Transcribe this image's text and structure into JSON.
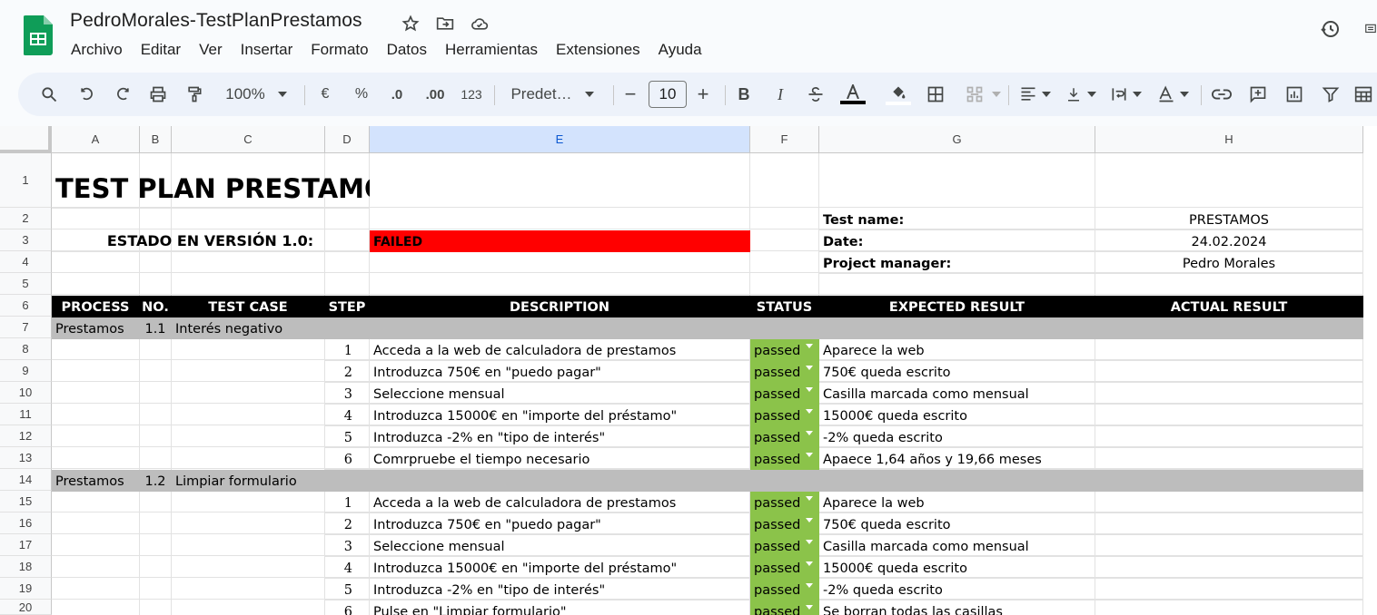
{
  "app": {
    "title": "PedroMorales-TestPlanPrestamos",
    "menus": [
      "Archivo",
      "Editar",
      "Ver",
      "Insertar",
      "Formato",
      "Datos",
      "Herramientas",
      "Extensiones",
      "Ayuda"
    ]
  },
  "toolbar": {
    "zoom": "100%",
    "font": "Predet…",
    "font_size": "10",
    "currency": "€",
    "percent": "%",
    "dec_less": ".0",
    "dec_more": ".00",
    "number_format": "123",
    "bold": "B",
    "italic": "I",
    "icons": [
      "search-icon",
      "undo-icon",
      "redo-icon",
      "print-icon",
      "paint-format-icon",
      "strikethrough-icon",
      "text-color-icon",
      "fill-color-icon",
      "borders-icon",
      "merge-cells-icon",
      "align-icon",
      "valign-icon",
      "text-wrap-icon",
      "text-rotate-icon",
      "link-icon",
      "comment-icon",
      "chart-icon",
      "filter-icon",
      "table-icon"
    ]
  },
  "columns": [
    "A",
    "B",
    "C",
    "D",
    "E",
    "F",
    "G",
    "H"
  ],
  "rows": [
    "1",
    "2",
    "3",
    "4",
    "5",
    "6",
    "7",
    "8",
    "9",
    "10",
    "11",
    "12",
    "13",
    "14",
    "15",
    "16",
    "17",
    "18",
    "19",
    "20"
  ],
  "sheet": {
    "title": "TEST PLAN PRESTAMOS",
    "estado_label": "ESTADO EN VERSIÓN 1.0:",
    "estado_value": "FAILED",
    "test_name_label": "Test name:",
    "test_name": "PRESTAMOS",
    "date_label": "Date:",
    "date": "24.02.2024",
    "pm_label": "Project manager:",
    "pm": "Pedro Morales",
    "headers": [
      "PROCESS",
      "NO.",
      "TEST CASE",
      "STEP",
      "DESCRIPTION",
      "STATUS",
      "EXPECTED RESULT",
      "ACTUAL RESULT"
    ],
    "groups": [
      {
        "process": "Prestamos",
        "no": "1.1",
        "case": "Interés negativo",
        "steps": [
          {
            "step": "1",
            "desc": "Acceda a la web de calculadora de prestamos",
            "status": "passed",
            "expected": "Aparece la web"
          },
          {
            "step": "2",
            "desc": "Introduzca 750€ en \"puedo pagar\"",
            "status": "passed",
            "expected": "750€ queda escrito"
          },
          {
            "step": "3",
            "desc": "Seleccione mensual",
            "status": "passed",
            "expected": "Casilla marcada como mensual"
          },
          {
            "step": "4",
            "desc": "Introduzca 15000€ en \"importe del préstamo\"",
            "status": "passed",
            "expected": "15000€ queda escrito"
          },
          {
            "step": "5",
            "desc": "Introduzca -2% en \"tipo de interés\"",
            "status": "passed",
            "expected": "-2% queda escrito"
          },
          {
            "step": "6",
            "desc": "Comrpruebe el tiempo necesario",
            "status": "passed",
            "expected": "Apaece 1,64 años y 19,66 meses"
          }
        ]
      },
      {
        "process": "Prestamos",
        "no": "1.2",
        "case": "Limpiar formulario",
        "steps": [
          {
            "step": "1",
            "desc": "Acceda a la web de calculadora de prestamos",
            "status": "passed",
            "expected": "Aparece la web"
          },
          {
            "step": "2",
            "desc": "Introduzca 750€ en \"puedo pagar\"",
            "status": "passed",
            "expected": "750€ queda escrito"
          },
          {
            "step": "3",
            "desc": "Seleccione mensual",
            "status": "passed",
            "expected": "Casilla marcada como mensual"
          },
          {
            "step": "4",
            "desc": "Introduzca 15000€ en \"importe del préstamo\"",
            "status": "passed",
            "expected": "15000€ queda escrito"
          },
          {
            "step": "5",
            "desc": "Introduzca -2% en \"tipo de interés\"",
            "status": "passed",
            "expected": "-2% queda escrito"
          },
          {
            "step": "6",
            "desc": "Pulse en \"Limpiar formulario\"",
            "status": "passed",
            "expected": "Se borran todas las casillas"
          }
        ]
      }
    ]
  },
  "colors": {
    "failed": "#ff0000",
    "passed": "#8bc34a",
    "header_bg": "#000000",
    "group_bg": "#bdbdbd",
    "selected_col": "#d3e3fd"
  }
}
